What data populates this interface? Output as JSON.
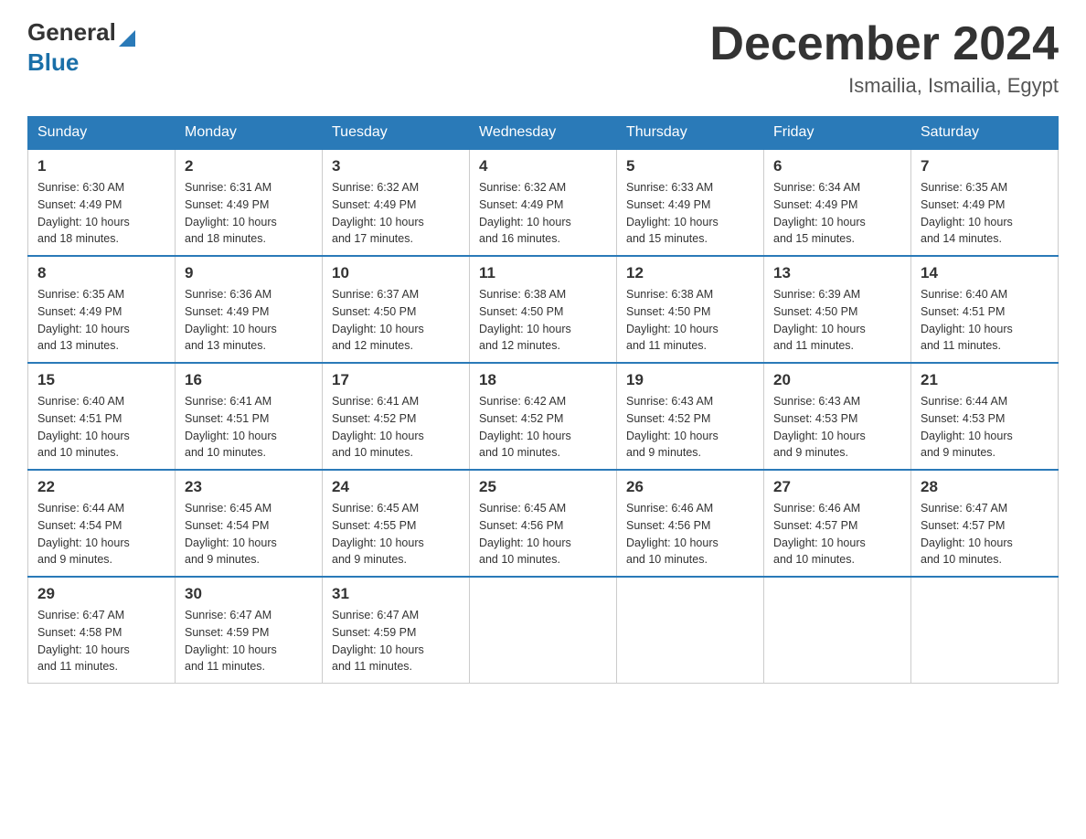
{
  "header": {
    "logo_general": "General",
    "logo_blue": "Blue",
    "month_title": "December 2024",
    "location": "Ismailia, Ismailia, Egypt"
  },
  "weekdays": [
    "Sunday",
    "Monday",
    "Tuesday",
    "Wednesday",
    "Thursday",
    "Friday",
    "Saturday"
  ],
  "weeks": [
    [
      {
        "day": "1",
        "sunrise": "6:30 AM",
        "sunset": "4:49 PM",
        "daylight": "10 hours and 18 minutes."
      },
      {
        "day": "2",
        "sunrise": "6:31 AM",
        "sunset": "4:49 PM",
        "daylight": "10 hours and 18 minutes."
      },
      {
        "day": "3",
        "sunrise": "6:32 AM",
        "sunset": "4:49 PM",
        "daylight": "10 hours and 17 minutes."
      },
      {
        "day": "4",
        "sunrise": "6:32 AM",
        "sunset": "4:49 PM",
        "daylight": "10 hours and 16 minutes."
      },
      {
        "day": "5",
        "sunrise": "6:33 AM",
        "sunset": "4:49 PM",
        "daylight": "10 hours and 15 minutes."
      },
      {
        "day": "6",
        "sunrise": "6:34 AM",
        "sunset": "4:49 PM",
        "daylight": "10 hours and 15 minutes."
      },
      {
        "day": "7",
        "sunrise": "6:35 AM",
        "sunset": "4:49 PM",
        "daylight": "10 hours and 14 minutes."
      }
    ],
    [
      {
        "day": "8",
        "sunrise": "6:35 AM",
        "sunset": "4:49 PM",
        "daylight": "10 hours and 13 minutes."
      },
      {
        "day": "9",
        "sunrise": "6:36 AM",
        "sunset": "4:49 PM",
        "daylight": "10 hours and 13 minutes."
      },
      {
        "day": "10",
        "sunrise": "6:37 AM",
        "sunset": "4:50 PM",
        "daylight": "10 hours and 12 minutes."
      },
      {
        "day": "11",
        "sunrise": "6:38 AM",
        "sunset": "4:50 PM",
        "daylight": "10 hours and 12 minutes."
      },
      {
        "day": "12",
        "sunrise": "6:38 AM",
        "sunset": "4:50 PM",
        "daylight": "10 hours and 11 minutes."
      },
      {
        "day": "13",
        "sunrise": "6:39 AM",
        "sunset": "4:50 PM",
        "daylight": "10 hours and 11 minutes."
      },
      {
        "day": "14",
        "sunrise": "6:40 AM",
        "sunset": "4:51 PM",
        "daylight": "10 hours and 11 minutes."
      }
    ],
    [
      {
        "day": "15",
        "sunrise": "6:40 AM",
        "sunset": "4:51 PM",
        "daylight": "10 hours and 10 minutes."
      },
      {
        "day": "16",
        "sunrise": "6:41 AM",
        "sunset": "4:51 PM",
        "daylight": "10 hours and 10 minutes."
      },
      {
        "day": "17",
        "sunrise": "6:41 AM",
        "sunset": "4:52 PM",
        "daylight": "10 hours and 10 minutes."
      },
      {
        "day": "18",
        "sunrise": "6:42 AM",
        "sunset": "4:52 PM",
        "daylight": "10 hours and 10 minutes."
      },
      {
        "day": "19",
        "sunrise": "6:43 AM",
        "sunset": "4:52 PM",
        "daylight": "10 hours and 9 minutes."
      },
      {
        "day": "20",
        "sunrise": "6:43 AM",
        "sunset": "4:53 PM",
        "daylight": "10 hours and 9 minutes."
      },
      {
        "day": "21",
        "sunrise": "6:44 AM",
        "sunset": "4:53 PM",
        "daylight": "10 hours and 9 minutes."
      }
    ],
    [
      {
        "day": "22",
        "sunrise": "6:44 AM",
        "sunset": "4:54 PM",
        "daylight": "10 hours and 9 minutes."
      },
      {
        "day": "23",
        "sunrise": "6:45 AM",
        "sunset": "4:54 PM",
        "daylight": "10 hours and 9 minutes."
      },
      {
        "day": "24",
        "sunrise": "6:45 AM",
        "sunset": "4:55 PM",
        "daylight": "10 hours and 9 minutes."
      },
      {
        "day": "25",
        "sunrise": "6:45 AM",
        "sunset": "4:56 PM",
        "daylight": "10 hours and 10 minutes."
      },
      {
        "day": "26",
        "sunrise": "6:46 AM",
        "sunset": "4:56 PM",
        "daylight": "10 hours and 10 minutes."
      },
      {
        "day": "27",
        "sunrise": "6:46 AM",
        "sunset": "4:57 PM",
        "daylight": "10 hours and 10 minutes."
      },
      {
        "day": "28",
        "sunrise": "6:47 AM",
        "sunset": "4:57 PM",
        "daylight": "10 hours and 10 minutes."
      }
    ],
    [
      {
        "day": "29",
        "sunrise": "6:47 AM",
        "sunset": "4:58 PM",
        "daylight": "10 hours and 11 minutes."
      },
      {
        "day": "30",
        "sunrise": "6:47 AM",
        "sunset": "4:59 PM",
        "daylight": "10 hours and 11 minutes."
      },
      {
        "day": "31",
        "sunrise": "6:47 AM",
        "sunset": "4:59 PM",
        "daylight": "10 hours and 11 minutes."
      },
      null,
      null,
      null,
      null
    ]
  ],
  "labels": {
    "sunrise": "Sunrise:",
    "sunset": "Sunset:",
    "daylight": "Daylight:"
  }
}
